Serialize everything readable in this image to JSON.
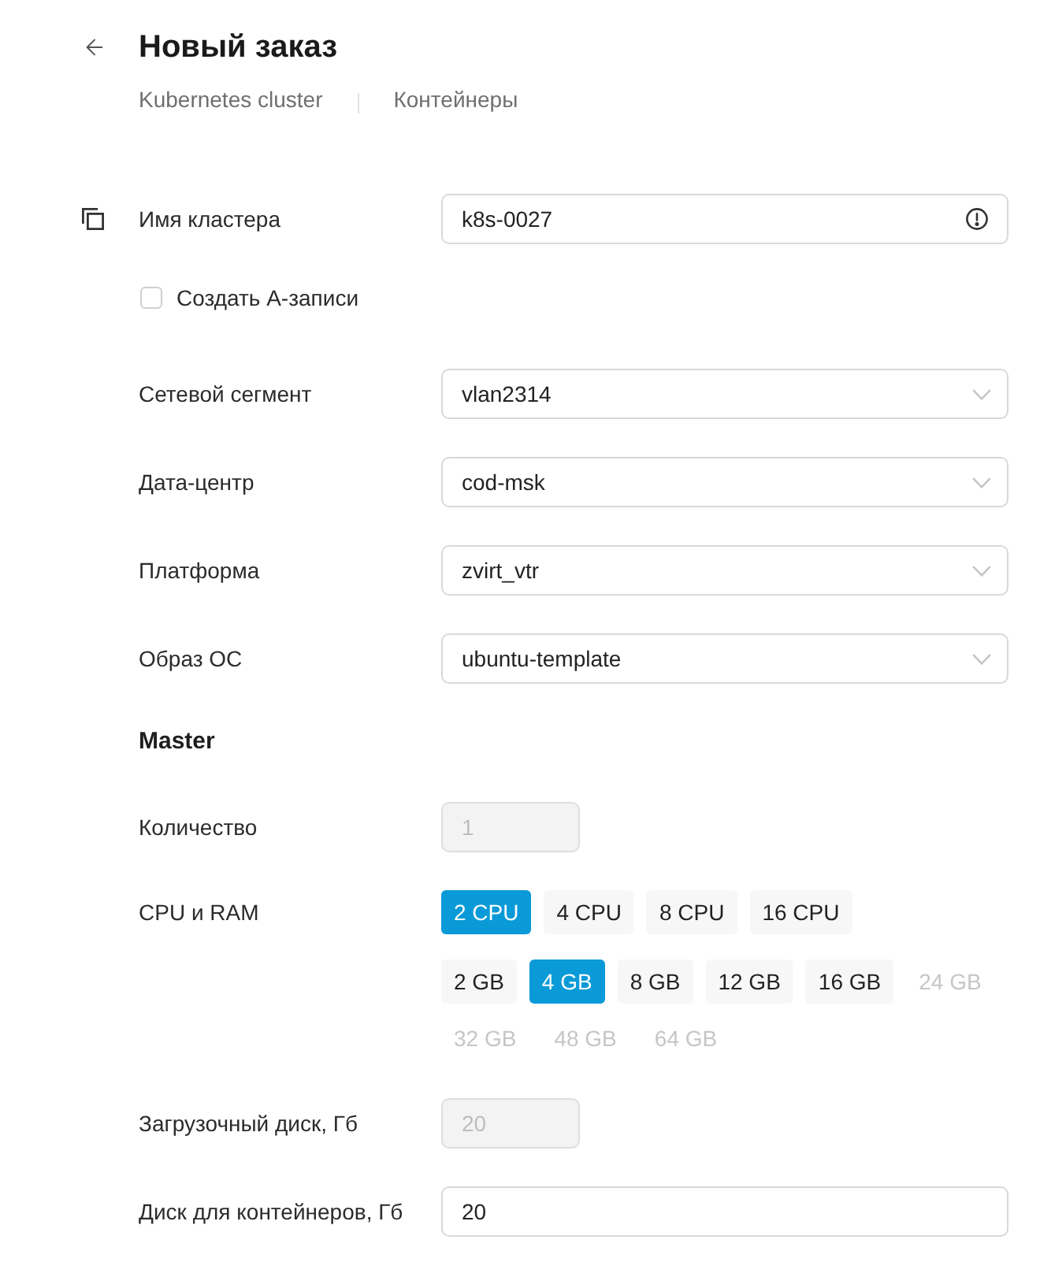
{
  "header": {
    "title": "Новый заказ",
    "breadcrumbs": [
      {
        "label": "Kubernetes cluster"
      },
      {
        "label": "Контейнеры"
      }
    ]
  },
  "form": [
    {
      "kind": "field",
      "label": "Имя кластера",
      "value": "k8s-0027",
      "disabled": false,
      "warning": true,
      "copyable": true
    },
    {
      "kind": "checkbox",
      "label": "Создать А-записи",
      "checked": false
    },
    {
      "kind": "select",
      "label": "Сетевой сегмент",
      "value": "vlan2314"
    },
    {
      "kind": "select",
      "label": "Дата-центр",
      "value": "cod-msk"
    },
    {
      "kind": "select",
      "label": "Платформа",
      "value": "zvirt_vtr"
    },
    {
      "kind": "select",
      "label": "Образ ОС",
      "value": "ubuntu-template"
    },
    {
      "kind": "heading",
      "label": "Master"
    },
    {
      "kind": "short_field",
      "label": "Количество",
      "value": "1",
      "disabled": true
    },
    {
      "kind": "chips",
      "label": "CPU и RAM",
      "groups": [
        {
          "options": [
            {
              "label": "2 CPU",
              "selected": true,
              "disabled": false
            },
            {
              "label": "4 CPU",
              "selected": false,
              "disabled": false
            },
            {
              "label": "8 CPU",
              "selected": false,
              "disabled": false
            },
            {
              "label": "16 CPU",
              "selected": false,
              "disabled": false
            }
          ]
        },
        {
          "options": [
            {
              "label": "2 GB",
              "selected": false,
              "disabled": false
            },
            {
              "label": "4 GB",
              "selected": true,
              "disabled": false
            },
            {
              "label": "8 GB",
              "selected": false,
              "disabled": false
            },
            {
              "label": "12 GB",
              "selected": false,
              "disabled": false
            },
            {
              "label": "16 GB",
              "selected": false,
              "disabled": false
            },
            {
              "label": "24 GB",
              "selected": false,
              "disabled": true
            },
            {
              "label": "32 GB",
              "selected": false,
              "disabled": true
            },
            {
              "label": "48 GB",
              "selected": false,
              "disabled": true
            },
            {
              "label": "64 GB",
              "selected": false,
              "disabled": true
            }
          ]
        }
      ]
    },
    {
      "kind": "short_field",
      "label": "Загрузочный диск, Гб",
      "value": "20",
      "disabled": true
    },
    {
      "kind": "field",
      "label": "Диск для контейнеров, Гб",
      "value": "20",
      "disabled": false
    }
  ]
}
